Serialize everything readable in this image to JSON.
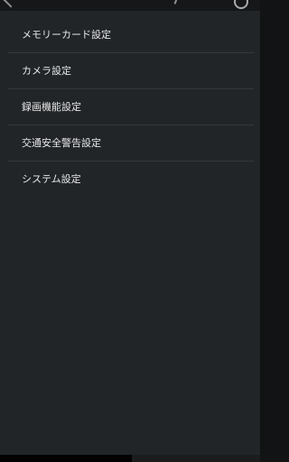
{
  "top_bar": {
    "icons": [
      "back-icon",
      "indicator-icon",
      "info-icon"
    ]
  },
  "settings_menu": {
    "items": [
      {
        "label": "メモリーカード設定"
      },
      {
        "label": "カメラ設定"
      },
      {
        "label": "録画機能設定"
      },
      {
        "label": "交通安全警告設定"
      },
      {
        "label": "システム設定"
      }
    ]
  },
  "colors": {
    "panel_background": "#222528",
    "divider": "#34383c",
    "text": "#e6e7e8",
    "top_bar": "#151718",
    "bottom_bar": "#000000"
  }
}
